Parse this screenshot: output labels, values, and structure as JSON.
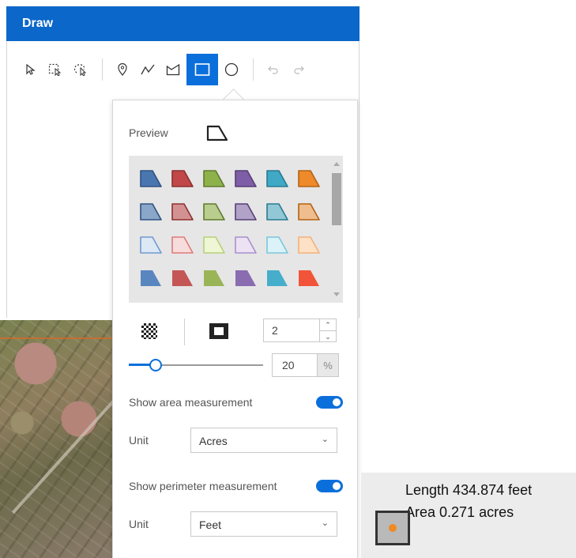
{
  "panel": {
    "title": "Draw"
  },
  "toolbar": {
    "tools": [
      {
        "name": "select",
        "icon": "select-arrow-icon"
      },
      {
        "name": "rectangle-select",
        "icon": "rectangle-select-icon"
      },
      {
        "name": "lasso-select",
        "icon": "lasso-select-icon"
      },
      {
        "name": "point",
        "icon": "point-marker-icon"
      },
      {
        "name": "polyline",
        "icon": "polyline-icon"
      },
      {
        "name": "polygon",
        "icon": "polygon-icon"
      },
      {
        "name": "rectangle",
        "icon": "rectangle-icon",
        "active": true
      },
      {
        "name": "circle",
        "icon": "circle-icon"
      },
      {
        "name": "undo",
        "icon": "undo-icon"
      },
      {
        "name": "redo",
        "icon": "redo-icon"
      }
    ]
  },
  "symbol": {
    "preview_label": "Preview",
    "swatch_rows": [
      [
        {
          "fill": "#4a76b0",
          "stroke": "#2f5282"
        },
        {
          "fill": "#c04848",
          "stroke": "#8e2f2f"
        },
        {
          "fill": "#8eb24a",
          "stroke": "#607a2e"
        },
        {
          "fill": "#7e5ea6",
          "stroke": "#573f75"
        },
        {
          "fill": "#3fa9c6",
          "stroke": "#2a7a91"
        },
        {
          "fill": "#ee8a2a",
          "stroke": "#b36214"
        }
      ],
      [
        {
          "fill": "#8aa6c8",
          "stroke": "#2f5282"
        },
        {
          "fill": "#d39292",
          "stroke": "#8e2f2f"
        },
        {
          "fill": "#b9cd8e",
          "stroke": "#607a2e"
        },
        {
          "fill": "#b1a2c8",
          "stroke": "#573f75"
        },
        {
          "fill": "#92c8d6",
          "stroke": "#2a7a91"
        },
        {
          "fill": "#efbd8e",
          "stroke": "#b36214"
        }
      ],
      [
        {
          "fill": "#dde8f5",
          "stroke": "#6f9ad0"
        },
        {
          "fill": "#f7dcdc",
          "stroke": "#e07a7a"
        },
        {
          "fill": "#eef6d5",
          "stroke": "#b6d17a"
        },
        {
          "fill": "#ece2f4",
          "stroke": "#a890cc"
        },
        {
          "fill": "#daf2f8",
          "stroke": "#7cc6dc"
        },
        {
          "fill": "#fde1c6",
          "stroke": "#f4b17a"
        }
      ],
      [
        {
          "fill": "#5a86c0",
          "stroke": "none"
        },
        {
          "fill": "#c45656",
          "stroke": "none"
        },
        {
          "fill": "#9ab558",
          "stroke": "none"
        },
        {
          "fill": "#8a6cb0",
          "stroke": "none"
        },
        {
          "fill": "#46aecb",
          "stroke": "none"
        },
        {
          "fill": "#f2543a",
          "stroke": "none"
        },
        {
          "fill": "#f5a24a",
          "stroke": "none"
        }
      ]
    ],
    "stroke_width": "2",
    "opacity": {
      "value": "20",
      "unit": "%",
      "fraction": 0.2
    },
    "show_area_label": "Show area measurement",
    "show_area_on": true,
    "area_unit_label": "Unit",
    "area_unit_value": "Acres",
    "show_perimeter_label": "Show perimeter measurement",
    "show_perimeter_on": true,
    "perimeter_unit_label": "Unit",
    "perimeter_unit_value": "Feet"
  },
  "measurement": {
    "length_text": "Length 434.874 feet",
    "area_text": "Area 0.271 acres"
  }
}
